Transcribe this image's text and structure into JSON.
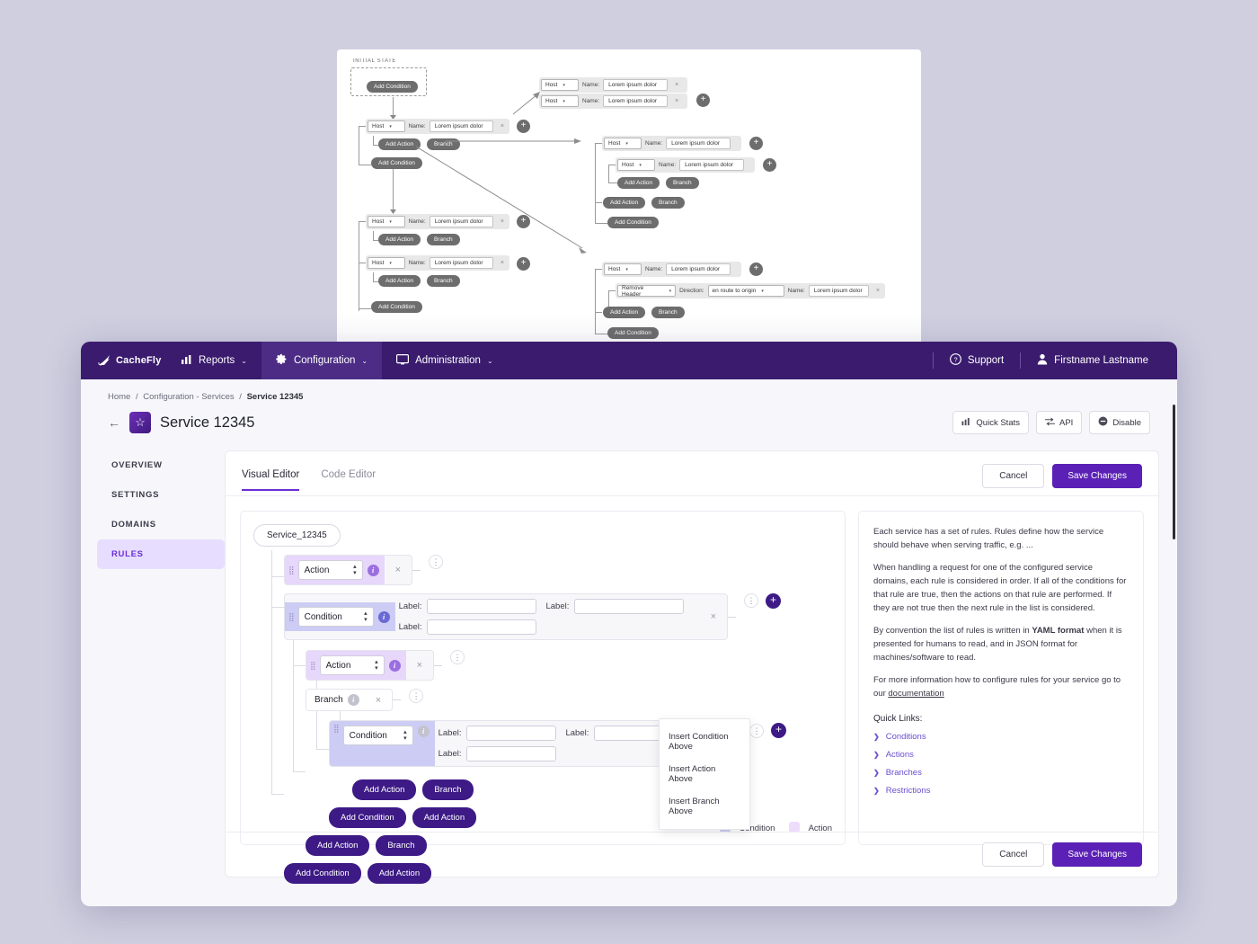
{
  "topbar": {
    "brand": "CacheFly",
    "nav": [
      {
        "label": "Reports",
        "icon": "chart-bar-icon",
        "caret": "⌄"
      },
      {
        "label": "Configuration",
        "icon": "gear-icon",
        "caret": "⌄"
      },
      {
        "label": "Administration",
        "icon": "monitor-icon",
        "caret": "⌄"
      }
    ],
    "support": "Support",
    "user": "Firstname Lastname"
  },
  "breadcrumb": {
    "home": "Home",
    "section": "Configuration - Services",
    "current": "Service 12345",
    "separator": "/"
  },
  "header": {
    "title": "Service 12345",
    "back": "←",
    "star": "☆",
    "actions": [
      {
        "label": "Quick Stats",
        "icon": "stats-icon"
      },
      {
        "label": "API",
        "icon": "transfer-icon"
      },
      {
        "label": "Disable",
        "icon": "minus-circle-icon"
      }
    ]
  },
  "sidebar": {
    "items": [
      {
        "label": "OVERVIEW",
        "active": false
      },
      {
        "label": "SETTINGS",
        "active": false
      },
      {
        "label": "DOMAINS",
        "active": false
      },
      {
        "label": "RULES",
        "active": true
      }
    ]
  },
  "editor": {
    "tabs": [
      {
        "label": "Visual Editor",
        "active": true
      },
      {
        "label": "Code Editor",
        "active": false
      }
    ],
    "cancel": "Cancel",
    "save": "Save Changes"
  },
  "tree": {
    "root_chip": "Service_12345",
    "node_action": "Action",
    "node_condition": "Condition",
    "node_branch": "Branch",
    "info_glyph": "i",
    "close_glyph": "×",
    "kebab_glyph": "⋮",
    "plus_glyph": "+",
    "label_text": "Label:",
    "field_value": "",
    "field_placeholder": "",
    "buttons": {
      "add_action": "Add Action",
      "branch": "Branch",
      "add_condition": "Add Condition"
    },
    "context_menu": [
      "Insert Condition Above",
      "Insert Action Above",
      "Insert Branch Above"
    ],
    "legend": [
      {
        "label": "Condition",
        "color": "#ccccf4"
      },
      {
        "label": "Action",
        "color": "#e7d7fb"
      }
    ]
  },
  "info": {
    "p1": "Each service has a set of rules. Rules define how the service should behave when serving traffic, e.g. ...",
    "p2": "When handling a request for one of the configured service domains, each rule is considered in order. If all of the conditions for that rule are true, then the actions on that rule are performed. If they are not true then the next rule in the list is considered.",
    "p3_a": "By convention the list of rules is written in ",
    "p3_b": "YAML format",
    "p3_c": " when it is presented for humans to read, and in JSON format for machines/software to read.",
    "p4_a": "For more information how to configure rules for your service go to our ",
    "p4_link": "documentation",
    "quick_links_title": "Quick Links:",
    "quick_links": [
      "Conditions",
      "Actions",
      "Branches",
      "Restrictions"
    ],
    "chevron": "❯"
  },
  "footer": {
    "cancel": "Cancel",
    "save": "Save Changes"
  },
  "wireframe": {
    "initial_state": "INITIAL STATE",
    "add_condition": "Add Condition",
    "add_action": "Add Action",
    "branch": "Branch",
    "host": "Host",
    "name_label": "Name:",
    "value": "Lorem ipsum dolor",
    "remove_header": "Remove Header",
    "direction_label": "Direction:",
    "direction_value": "en route to origin",
    "plus": "+",
    "close": "×",
    "caret": "▾"
  }
}
